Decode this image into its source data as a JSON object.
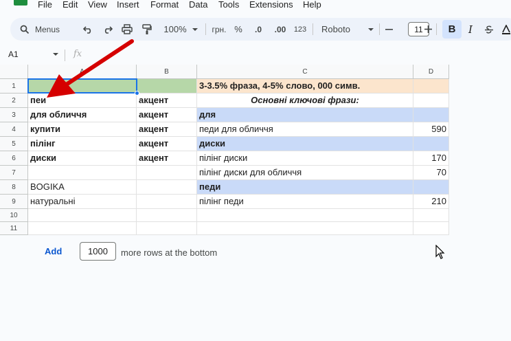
{
  "menu": [
    "File",
    "Edit",
    "View",
    "Insert",
    "Format",
    "Data",
    "Tools",
    "Extensions",
    "Help"
  ],
  "toolbar": {
    "menus_label": "Menus",
    "zoom": "100%",
    "currency": "грн.",
    "percent": "%",
    "decimal_decrease": ".0",
    "decimal_increase": ".00",
    "number_format": "123",
    "font": "Roboto",
    "font_size": "11",
    "bold": "B",
    "italic": "I"
  },
  "namebox": {
    "cell": "A1",
    "fx": "fx"
  },
  "sheet": {
    "columns": [
      "A",
      "B",
      "C",
      "D"
    ],
    "rows": [
      {
        "n": "1",
        "a": "",
        "b": "",
        "c": "3-3.5% фраза, 4-5% слово, 000 симв.",
        "d": ""
      },
      {
        "n": "2",
        "a": "пеи",
        "b": "акцент",
        "c": "Основні ключові фрази:",
        "d": ""
      },
      {
        "n": "3",
        "a": "для обличчя",
        "b": "акцент",
        "c": "для",
        "d": ""
      },
      {
        "n": "4",
        "a": "купити",
        "b": "акцент",
        "c": "педи для обличчя",
        "d": "590"
      },
      {
        "n": "5",
        "a": "пілінг",
        "b": "акцент",
        "c": "диски",
        "d": ""
      },
      {
        "n": "6",
        "a": "диски",
        "b": "акцент",
        "c": "пілінг диски",
        "d": "170"
      },
      {
        "n": "7",
        "a": "",
        "b": "",
        "c": "пілінг диски для обличчя",
        "d": "70"
      },
      {
        "n": "8",
        "a": "BOGIKA",
        "b": "",
        "c": "педи",
        "d": ""
      },
      {
        "n": "9",
        "a": "натуральні",
        "b": "",
        "c": "пілінг педи",
        "d": "210"
      },
      {
        "n": "10",
        "a": "",
        "b": "",
        "c": "",
        "d": ""
      },
      {
        "n": "11",
        "a": "",
        "b": "",
        "c": "",
        "d": ""
      }
    ]
  },
  "footer": {
    "add_label": "Add",
    "rows_value": "1000",
    "rows_suffix": "more rows at the bottom"
  },
  "colors": {
    "green": "#b6d7a8",
    "peach": "#fce5cd",
    "blue": "#c9daf8",
    "arrow": "#d50000",
    "selection": "#1a73e8"
  }
}
